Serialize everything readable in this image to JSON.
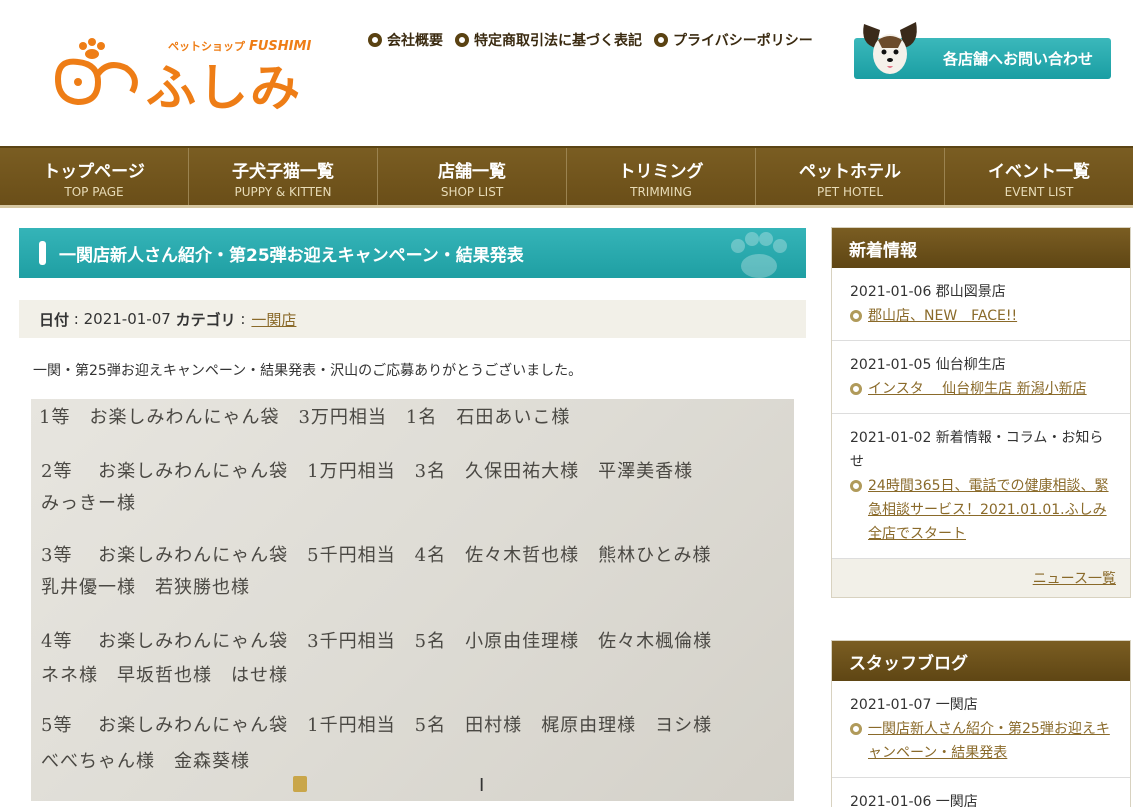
{
  "header": {
    "logo_kana": "ふしみ",
    "logo_sub": "ペットショップ",
    "logo_sub_en": "FUSHIMI",
    "links": [
      "会社概要",
      "特定商取引法に基づく表記",
      "プライバシーポリシー"
    ],
    "contact_button": "各店舗へお問い合わせ"
  },
  "nav": [
    {
      "jp": "トップページ",
      "en": "TOP PAGE"
    },
    {
      "jp": "子犬子猫一覧",
      "en": "PUPPY & KITTEN"
    },
    {
      "jp": "店舗一覧",
      "en": "SHOP LIST"
    },
    {
      "jp": "トリミング",
      "en": "TRIMMING"
    },
    {
      "jp": "ペットホテル",
      "en": "PET HOTEL"
    },
    {
      "jp": "イベント一覧",
      "en": "EVENT LIST"
    }
  ],
  "article": {
    "title": "一関店新人さん紹介・第25弾お迎えキャンペーン・結果発表",
    "date_label": "日付",
    "date": "2021-01-07",
    "category_label": "カテゴリ",
    "category": "一関店",
    "intro": "一関・第25弾お迎えキャンペーン・結果発表・沢山のご応募ありがとうございました。",
    "photo_lines": [
      "1等　お楽しみわんにゃん袋　3万円相当　1名　石田あいこ様",
      "2等　 お楽しみわんにゃん袋　1万円相当　3名　久保田祐大様　平澤美香様",
      "みっきー様",
      "3等　 お楽しみわんにゃん袋　5千円相当　4名　佐々木哲也様　熊林ひとみ様",
      "乳井優一様　若狭勝也様",
      "4等　 お楽しみわんにゃん袋　3千円相当　5名　小原由佳理様　佐々木楓倫様",
      "ネネ様　早坂哲也様　はせ様",
      "5等　 お楽しみわんにゃん袋　1千円相当　5名　田村様　梶原由理様　ヨシ様",
      "べべちゃん様　金森葵様"
    ]
  },
  "sidebar": {
    "news": {
      "heading": "新着情報",
      "items": [
        {
          "date": "2021-01-06 郡山図景店",
          "link": "郡山店、NEW　FACE!!"
        },
        {
          "date": "2021-01-05 仙台柳生店",
          "link": "インスタ　 仙台柳生店 新潟小新店"
        },
        {
          "date": "2021-01-02 新着情報・コラム・お知らせ",
          "link": "24時間365日、電話での健康相談、緊急相談サービス！2021.01.01.ふしみ全店でスタート"
        }
      ],
      "more": "ニュース一覧"
    },
    "blog": {
      "heading": "スタッフブログ",
      "items": [
        {
          "date": "2021-01-07 一関店",
          "link": "一関店新人さん紹介・第25弾お迎えキャンペーン・結果発表"
        },
        {
          "date": "2021-01-06 一関店",
          "link": ""
        }
      ]
    }
  },
  "colors": {
    "brown": "#6a4e18",
    "teal": "#1f9fa3",
    "orange": "#ee7d16",
    "link": "#8a6a2a"
  }
}
